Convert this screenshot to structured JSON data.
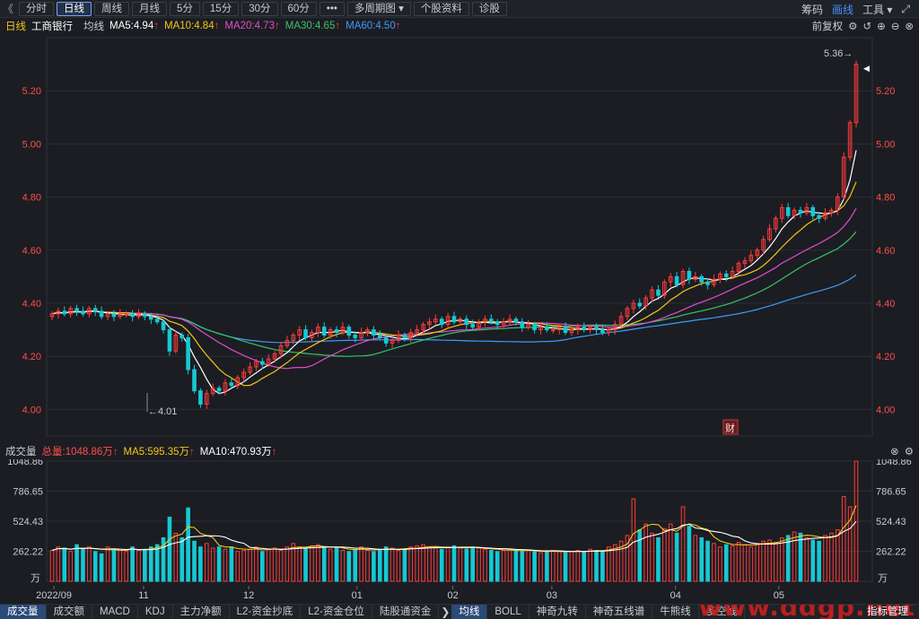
{
  "toolbar": {
    "back_icon": "double-chevron-left-icon",
    "tabs": [
      {
        "label": "分时"
      },
      {
        "label": "日线",
        "active": true
      },
      {
        "label": "周线"
      },
      {
        "label": "月线"
      },
      {
        "label": "5分"
      },
      {
        "label": "15分"
      },
      {
        "label": "30分"
      },
      {
        "label": "60分"
      },
      {
        "label": "•••"
      },
      {
        "label": "多周期图 ▾"
      },
      {
        "label": "个股资料"
      },
      {
        "label": "诊股"
      }
    ],
    "right": {
      "chip": "筹码",
      "draw": "画线",
      "tools": "工具 ▾",
      "expand_icon": "expand-icon"
    }
  },
  "legend": {
    "period": "日线",
    "stock": "工商银行",
    "avg_label": "均线",
    "ma5": "MA5:4.94",
    "ma10": "MA10:4.84",
    "ma20": "MA20:4.73",
    "ma30": "MA30:4.65",
    "ma60": "MA60:4.50",
    "arrow": "↑",
    "adjust": "前复权",
    "colors": {
      "ma5": "#ffffff",
      "ma10": "#f5c518",
      "ma20": "#e24ccf",
      "ma30": "#39c46a",
      "ma60": "#3d9bff",
      "up": "#ff3b3b",
      "down": "#17c8d4"
    }
  },
  "price_chart": {
    "y_ticks": [
      "5.20",
      "5.00",
      "4.80",
      "4.60",
      "4.40",
      "4.20",
      "4.00"
    ],
    "high_label": "5.36→",
    "low_label": "←4.01",
    "event_marker": "财"
  },
  "volume": {
    "title": "成交量",
    "total": "总量:1048.86万",
    "ma5": "MA5:595.35万",
    "ma10": "MA10:470.93万",
    "arrow": "↑",
    "y_ticks": [
      "1048.86",
      "786.65",
      "524.43",
      "262.22"
    ],
    "unit": "万"
  },
  "x_axis": {
    "labels": [
      "2022/09",
      "11",
      "12",
      "01",
      "02",
      "03",
      "04",
      "05"
    ]
  },
  "indicator_tabs": {
    "left": [
      "成交量",
      "成交额",
      "MACD",
      "KDJ",
      "主力净额",
      "L2-资金抄底",
      "L2-资金仓位",
      "陆股通资金"
    ],
    "more": "❯",
    "right": [
      "均线",
      "BOLL",
      "神奇九转",
      "神奇五线谱",
      "牛熊线",
      "多空线"
    ],
    "manage": "指标管理"
  },
  "watermark": "www.ddgp.net",
  "chart_data": {
    "type": "candlestick",
    "price_axis": {
      "ylim": [
        3.9,
        5.4
      ],
      "ticks": [
        4.0,
        4.2,
        4.4,
        4.6,
        4.8,
        5.0,
        5.2
      ]
    },
    "volume_axis": {
      "ylim": [
        0,
        1048.86
      ],
      "ticks": [
        262.22,
        524.43,
        786.65,
        1048.86
      ],
      "unit": "万"
    },
    "high_marker": 5.36,
    "low_marker": 4.01,
    "current_ma": {
      "MA5": 4.94,
      "MA10": 4.84,
      "MA20": 4.73,
      "MA30": 4.65,
      "MA60": 4.5
    },
    "close": [
      4.36,
      4.37,
      4.36,
      4.38,
      4.37,
      4.36,
      4.38,
      4.37,
      4.35,
      4.36,
      4.35,
      4.36,
      4.36,
      4.35,
      4.36,
      4.35,
      4.34,
      4.33,
      4.3,
      4.22,
      4.28,
      4.27,
      4.15,
      4.07,
      4.02,
      4.06,
      4.08,
      4.07,
      4.1,
      4.09,
      4.12,
      4.14,
      4.16,
      4.18,
      4.17,
      4.19,
      4.21,
      4.24,
      4.26,
      4.28,
      4.3,
      4.27,
      4.29,
      4.31,
      4.28,
      4.3,
      4.29,
      4.31,
      4.28,
      4.27,
      4.29,
      4.3,
      4.28,
      4.27,
      4.25,
      4.26,
      4.28,
      4.27,
      4.29,
      4.3,
      4.32,
      4.33,
      4.34,
      4.32,
      4.35,
      4.33,
      4.34,
      4.32,
      4.31,
      4.33,
      4.34,
      4.33,
      4.32,
      4.33,
      4.34,
      4.33,
      4.31,
      4.32,
      4.3,
      4.31,
      4.3,
      4.3,
      4.31,
      4.29,
      4.3,
      4.31,
      4.3,
      4.31,
      4.3,
      4.29,
      4.3,
      4.32,
      4.35,
      4.38,
      4.4,
      4.39,
      4.42,
      4.45,
      4.43,
      4.48,
      4.5,
      4.47,
      4.52,
      4.49,
      4.5,
      4.48,
      4.47,
      4.49,
      4.51,
      4.5,
      4.52,
      4.55,
      4.56,
      4.58,
      4.6,
      4.64,
      4.68,
      4.72,
      4.76,
      4.73,
      4.75,
      4.74,
      4.76,
      4.73,
      4.72,
      4.74,
      4.75,
      4.8,
      4.95,
      5.08,
      5.3
    ],
    "volume": [
      270,
      300,
      290,
      260,
      320,
      280,
      300,
      260,
      240,
      300,
      280,
      270,
      260,
      300,
      270,
      280,
      300,
      320,
      380,
      560,
      420,
      380,
      640,
      350,
      300,
      330,
      290,
      300,
      280,
      300,
      260,
      270,
      280,
      300,
      260,
      280,
      290,
      270,
      300,
      330,
      300,
      290,
      310,
      320,
      300,
      280,
      290,
      270,
      260,
      280,
      300,
      270,
      260,
      280,
      300,
      290,
      270,
      280,
      300,
      310,
      320,
      300,
      290,
      280,
      300,
      310,
      290,
      280,
      300,
      290,
      280,
      270,
      260,
      270,
      280,
      270,
      260,
      270,
      260,
      250,
      260,
      270,
      260,
      250,
      260,
      270,
      260,
      280,
      270,
      260,
      300,
      320,
      350,
      400,
      720,
      450,
      500,
      420,
      380,
      460,
      500,
      420,
      650,
      480,
      400,
      380,
      350,
      330,
      300,
      320,
      310,
      340,
      320,
      300,
      330,
      350,
      360,
      340,
      380,
      400,
      430,
      420,
      380,
      360,
      350,
      400,
      420,
      450,
      740,
      650,
      1048
    ]
  }
}
